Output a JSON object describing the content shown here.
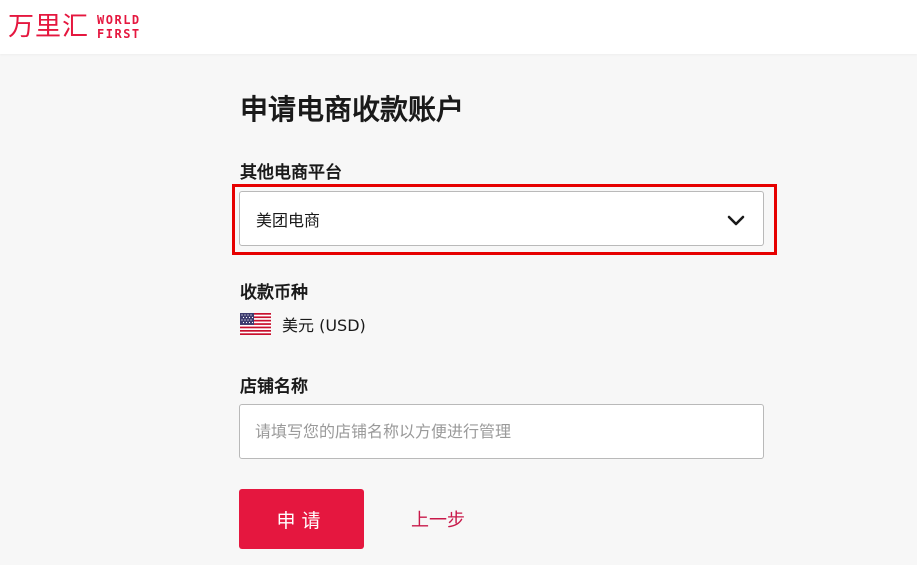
{
  "header": {
    "logo_cn": "万里汇",
    "logo_en_line1": "WORLD",
    "logo_en_line2": "FIRST"
  },
  "form": {
    "title": "申请电商收款账户",
    "platform_label": "其他电商平台",
    "platform_value": "美团电商",
    "currency_label": "收款币种",
    "currency_value": "美元 (USD)",
    "store_label": "店铺名称",
    "store_placeholder": "请填写您的店铺名称以方便进行管理",
    "store_value": "",
    "submit_label": "申请",
    "back_label": "上一步"
  },
  "colors": {
    "brand": "#e5173f",
    "highlight": "#e60000",
    "link": "#c8194a"
  },
  "icons": {
    "dropdown": "chevron-down-icon",
    "currency_flag": "us-flag-icon"
  }
}
